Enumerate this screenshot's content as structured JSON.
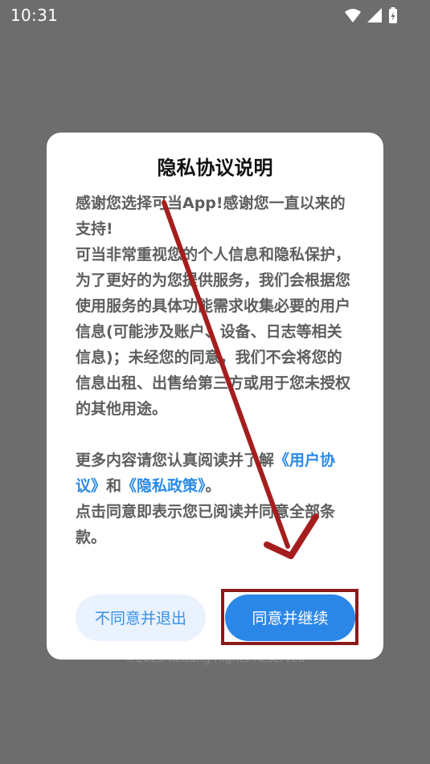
{
  "status_bar": {
    "time": "10:31",
    "icons": [
      "wifi-icon",
      "cellular-signal-icon",
      "battery-charging-icon"
    ]
  },
  "footer": {
    "copyright": "©2023 Kedang Rights Reserved"
  },
  "dialog": {
    "title": "隐私协议说明",
    "paragraph1": "感谢您选择可当App!感谢您一直以来的支持!",
    "paragraph2": "可当非常重视您的个人信息和隐私保护，为了更好的为您提供服务，我们会根据您使用服务的具体功能需求收集必要的用户信息(可能涉及账户、设备、日志等相关信息)；未经您的同意，我们不会将您的信息出租、出售给第三方或用于您未授权的其他用途。",
    "more_prefix": "更多内容请您认真阅读并了解",
    "user_agreement_link": "《用户协议》",
    "and_text": "和",
    "privacy_policy_link": "《隐私政策》",
    "period": "。",
    "consent_note": "点击同意即表示您已阅读并同意全部条款。",
    "decline_button": "不同意并退出",
    "agree_button": "同意并继续"
  },
  "colors": {
    "overlay": "#6d6d6d",
    "accent": "#2a87e8",
    "link": "#2b8ae6",
    "annotation": "#a51e1e"
  }
}
